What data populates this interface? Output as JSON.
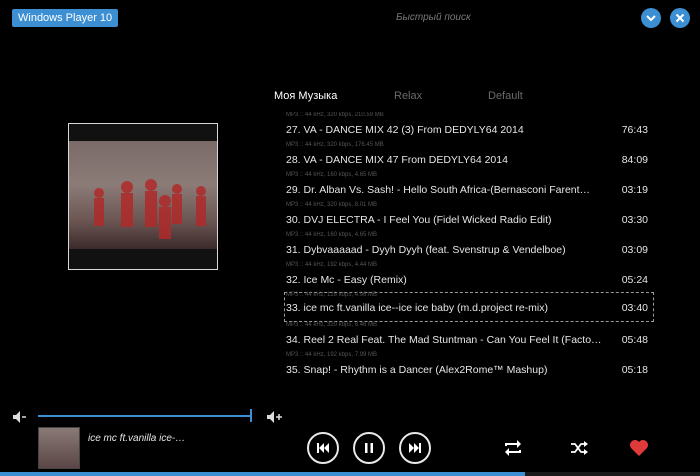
{
  "app": {
    "title": "Windows Player 10",
    "search_placeholder": "Быстрый поиск"
  },
  "tabs": [
    {
      "label": "Моя Музыка",
      "active": true
    },
    {
      "label": "Relax",
      "active": false
    },
    {
      "label": "Default",
      "active": false
    }
  ],
  "playlist": [
    {
      "meta": "MP3 :: 44 kHz, 320 kbps, 210.59 MB",
      "title": "27. VA - DANCE MIX 42 (3) From DEDYLY64  2014",
      "duration": "76:43"
    },
    {
      "meta": "MP3 :: 44 kHz, 320 kbps, 176.45 MB",
      "title": "28. VA - DANCE MIX 47 From DEDYLY64  2014",
      "duration": "84:09"
    },
    {
      "meta": "MP3 :: 44 kHz, 160 kbps, 4.65 MB",
      "title": "29. Dr. Alban Vs. Sash! - Hello South Africa-(Bernasconi  Farent…",
      "duration": "03:19"
    },
    {
      "meta": "MP3 :: 44 kHz, 320 kbps, 8.01 MB",
      "title": "30. DVJ ELECTRA - I Feel You (Fidel Wicked Radio Edit)",
      "duration": "03:30"
    },
    {
      "meta": "MP3 :: 44 kHz, 160 kbps, 4.65 MB",
      "title": "31. Dybvaaaaad - Dyyh Dyyh (feat. Svenstrup & Vendelboe)",
      "duration": "03:09"
    },
    {
      "meta": "MP3 :: 44 kHz, 192 kbps, 4.44 MB",
      "title": "32. Ice Mc - Easy (Remix)",
      "duration": "05:24"
    },
    {
      "meta": "MP3 :: 44 kHz, 128 kbps, 4.96 MB",
      "title": "33. ice mc ft.vanilla ice--ice ice baby (m.d.project re-mix)",
      "duration": "03:40",
      "selected": true
    },
    {
      "meta": "MP3 :: 44 kHz, 320 kbps, 8.46 MB",
      "title": "34. Reel 2 Real Feat. The Mad Stuntman - Can You Feel It (Facto…",
      "duration": "05:48"
    },
    {
      "meta": "MP3 :: 44 kHz, 192 kbps, 7.99 MB",
      "title": "35. Snap! - Rhythm is a Dancer (Alex2Rome™  Mashup)",
      "duration": "05:18"
    }
  ],
  "now_playing": {
    "title": "ice mc ft.vanilla ice-…"
  },
  "volume_level": 1.0,
  "playback_progress": 0.75,
  "colors": {
    "accent": "#3b8fd2",
    "heart": "#e03a3a",
    "background": "#000000"
  },
  "icons": {
    "minimize": "chevron-down-icon",
    "close": "close-icon",
    "volume_down": "volume-down-icon",
    "volume_up": "volume-up-icon",
    "prev": "skip-previous-icon",
    "pause": "pause-icon",
    "next": "skip-next-icon",
    "repeat": "repeat-icon",
    "shuffle": "shuffle-icon",
    "favorite": "heart-icon"
  }
}
